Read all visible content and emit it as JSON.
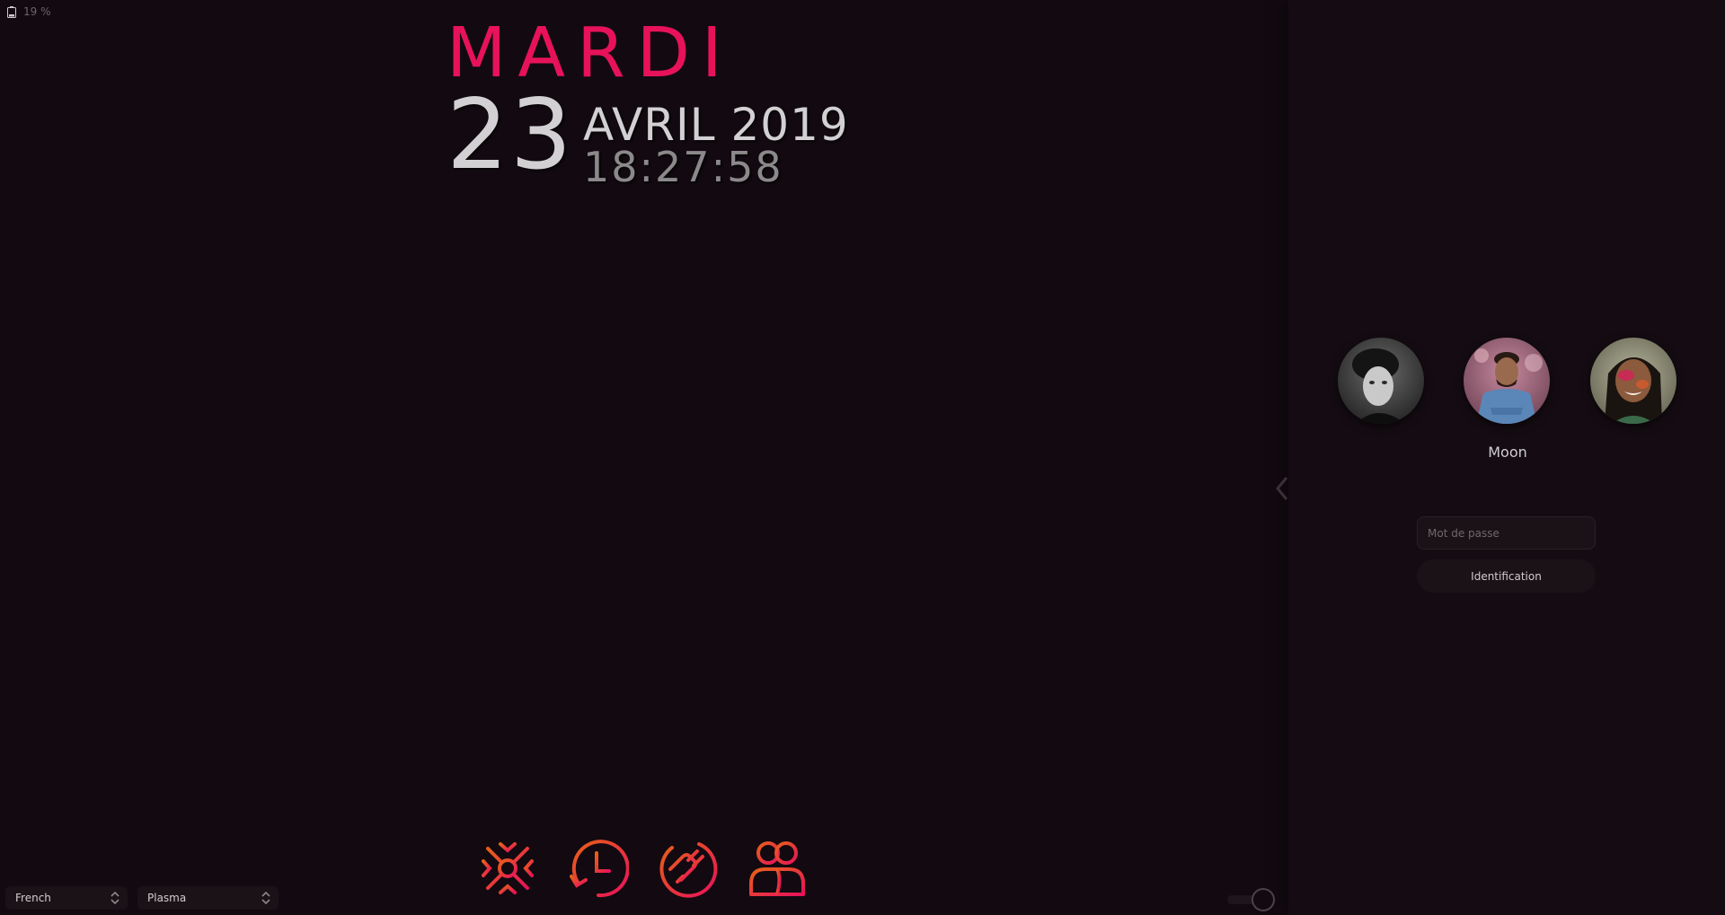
{
  "battery": {
    "percent_label": "19 %",
    "icon": "battery-icon"
  },
  "clock": {
    "day_name": "MARDI",
    "day_number": "23",
    "month_year": "AVRIL 2019",
    "time": "18:27:58"
  },
  "users": {
    "selected_name": "Moon",
    "avatars": [
      "user-avatar-1",
      "user-avatar-moon",
      "user-avatar-3"
    ]
  },
  "login": {
    "password_placeholder": "Mot de passe",
    "button_label": "Identification"
  },
  "actions": [
    {
      "name": "suspend",
      "icon": "snowflake-icon"
    },
    {
      "name": "hibernate",
      "icon": "clock-restart-icon"
    },
    {
      "name": "shutdown",
      "icon": "power-plug-icon"
    },
    {
      "name": "switch-user",
      "icon": "users-icon"
    }
  ],
  "bottom": {
    "keyboard_layout": "French",
    "session": "Plasma"
  },
  "colors": {
    "accent": "#e8125a",
    "accent_orange": "#e8501a",
    "background": "#120a10",
    "panel": "#140c12",
    "text": "#d2d0d2",
    "muted_text": "#8c898b"
  }
}
